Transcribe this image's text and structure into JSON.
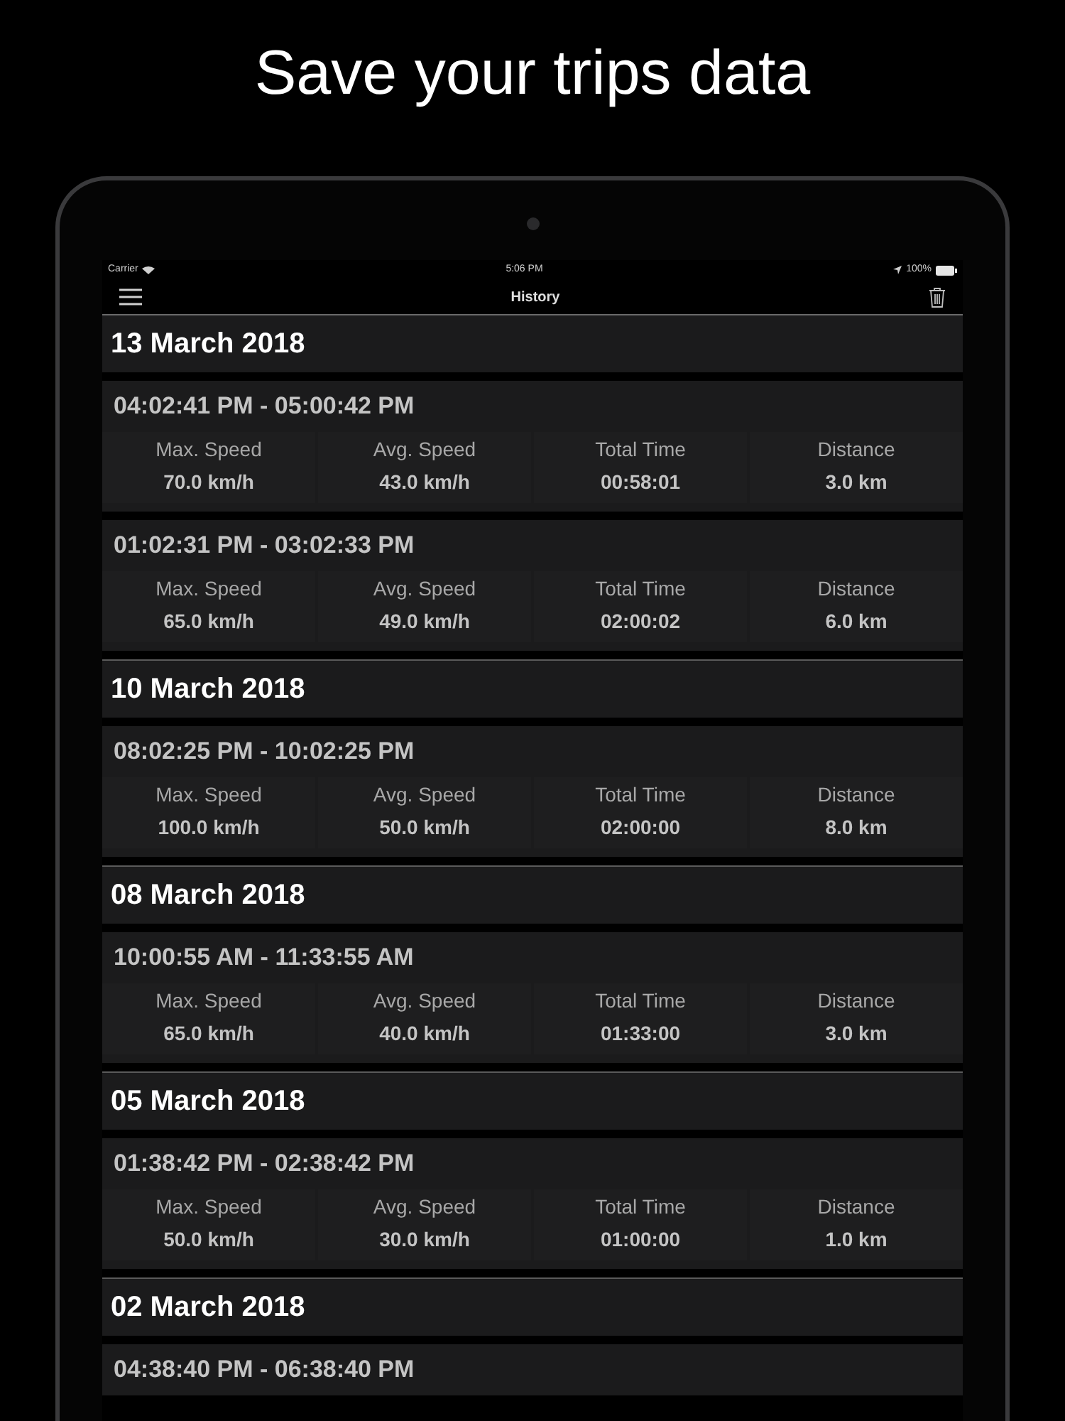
{
  "headline": "Save your trips data",
  "status_bar": {
    "carrier": "Carrier",
    "time": "5:06 PM",
    "battery": "100%"
  },
  "nav": {
    "title": "History"
  },
  "sections": [
    {
      "date": "13 March 2018",
      "trips": [
        {
          "time": "04:02:41 PM - 05:00:42 PM",
          "stats": [
            {
              "label": "Max. Speed",
              "value": "70.0 km/h"
            },
            {
              "label": "Avg. Speed",
              "value": "43.0 km/h"
            },
            {
              "label": "Total Time",
              "value": "00:58:01"
            },
            {
              "label": "Distance",
              "value": "3.0 km"
            }
          ]
        },
        {
          "time": "01:02:31 PM - 03:02:33 PM",
          "stats": [
            {
              "label": "Max. Speed",
              "value": "65.0 km/h"
            },
            {
              "label": "Avg. Speed",
              "value": "49.0 km/h"
            },
            {
              "label": "Total Time",
              "value": "02:00:02"
            },
            {
              "label": "Distance",
              "value": "6.0 km"
            }
          ]
        }
      ]
    },
    {
      "date": "10 March 2018",
      "trips": [
        {
          "time": "08:02:25 PM - 10:02:25 PM",
          "stats": [
            {
              "label": "Max. Speed",
              "value": "100.0 km/h"
            },
            {
              "label": "Avg. Speed",
              "value": "50.0 km/h"
            },
            {
              "label": "Total Time",
              "value": "02:00:00"
            },
            {
              "label": "Distance",
              "value": "8.0 km"
            }
          ]
        }
      ]
    },
    {
      "date": "08 March 2018",
      "trips": [
        {
          "time": "10:00:55 AM - 11:33:55 AM",
          "stats": [
            {
              "label": "Max. Speed",
              "value": "65.0 km/h"
            },
            {
              "label": "Avg. Speed",
              "value": "40.0 km/h"
            },
            {
              "label": "Total Time",
              "value": "01:33:00"
            },
            {
              "label": "Distance",
              "value": "3.0 km"
            }
          ]
        }
      ]
    },
    {
      "date": "05 March 2018",
      "trips": [
        {
          "time": "01:38:42 PM - 02:38:42 PM",
          "stats": [
            {
              "label": "Max. Speed",
              "value": "50.0 km/h"
            },
            {
              "label": "Avg. Speed",
              "value": "30.0 km/h"
            },
            {
              "label": "Total Time",
              "value": "01:00:00"
            },
            {
              "label": "Distance",
              "value": "1.0 km"
            }
          ]
        }
      ]
    },
    {
      "date": "02 March 2018",
      "trips": [
        {
          "time": "04:38:40 PM - 06:38:40 PM"
        }
      ]
    }
  ]
}
